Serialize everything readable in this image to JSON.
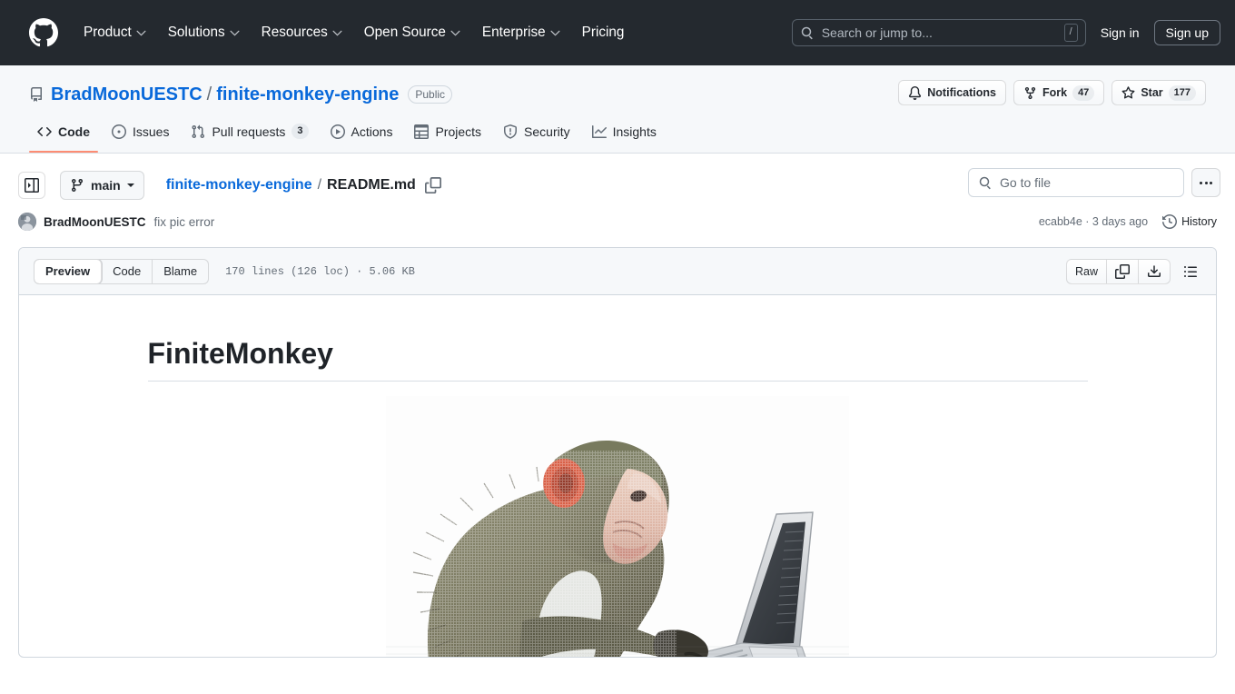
{
  "global_header": {
    "logo_icon": "github-mark-icon",
    "nav": [
      {
        "label": "Product",
        "has_chevron": true
      },
      {
        "label": "Solutions",
        "has_chevron": true
      },
      {
        "label": "Resources",
        "has_chevron": true
      },
      {
        "label": "Open Source",
        "has_chevron": true
      },
      {
        "label": "Enterprise",
        "has_chevron": true
      },
      {
        "label": "Pricing",
        "has_chevron": false
      }
    ],
    "search": {
      "placeholder": "Search or jump to...",
      "icon": "search-icon",
      "shortcut_key": "/"
    },
    "sign_in_label": "Sign in",
    "sign_up_label": "Sign up",
    "background_color": "#24292f"
  },
  "repo_header": {
    "repo_icon": "repo-icon",
    "owner": "BradMoonUESTC",
    "separator": "/",
    "name": "finite-monkey-engine",
    "visibility": "Public",
    "actions": [
      {
        "label": "Notifications",
        "icon": "bell-icon",
        "count": null
      },
      {
        "label": "Fork",
        "icon": "repo-forked-icon",
        "count": "47"
      },
      {
        "label": "Star",
        "icon": "star-icon",
        "count": "177"
      }
    ],
    "tabs": [
      {
        "label": "Code",
        "icon": "code-icon",
        "count": null,
        "selected": true
      },
      {
        "label": "Issues",
        "icon": "issue-opened-icon",
        "count": null,
        "selected": false
      },
      {
        "label": "Pull requests",
        "icon": "git-pull-request-icon",
        "count": "3",
        "selected": false
      },
      {
        "label": "Actions",
        "icon": "play-icon",
        "count": null,
        "selected": false
      },
      {
        "label": "Projects",
        "icon": "table-icon",
        "count": null,
        "selected": false
      },
      {
        "label": "Security",
        "icon": "shield-icon",
        "count": null,
        "selected": false
      },
      {
        "label": "Insights",
        "icon": "graph-icon",
        "count": null,
        "selected": false
      }
    ],
    "selected_tab_underline_color": "#fd8c73"
  },
  "file_nav": {
    "sidebar_toggle_icon": "sidebar-expand-icon",
    "branch": {
      "name": "main",
      "icon": "git-branch-icon"
    },
    "breadcrumb": {
      "root": "finite-monkey-engine",
      "separator": "/",
      "current": "README.md"
    },
    "copy_path_icon": "copy-icon",
    "go_to_file": {
      "placeholder": "Go to file",
      "icon": "search-icon"
    },
    "more_options_icon": "kebab-horizontal-icon"
  },
  "commit_row": {
    "avatar": "user-avatar",
    "author": "BradMoonUESTC",
    "message": "fix pic error",
    "sha": "ecabb4e",
    "sha_separator": "·",
    "relative_time": "3 days ago",
    "history_label": "History",
    "history_icon": "history-clock-icon"
  },
  "file_toolbar": {
    "view_tabs": [
      {
        "label": "Preview",
        "selected": true
      },
      {
        "label": "Code",
        "selected": false
      },
      {
        "label": "Blame",
        "selected": false
      }
    ],
    "file_meta": "170 lines (126 loc) · 5.06 KB",
    "raw_label": "Raw",
    "copy_icon": "copy-raw-icon",
    "download_icon": "download-icon",
    "outline_icon": "list-unordered-icon"
  },
  "readme": {
    "heading": "FiniteMonkey",
    "image_alt": "monkey typing on a laptop"
  },
  "colors": {
    "accent_blue": "#0969da",
    "header_dark": "#24292f",
    "border": "#d0d7de",
    "muted_text": "#636c76",
    "canvas_subtle": "#f6f8fa",
    "active_underline": "#fd8c73"
  }
}
